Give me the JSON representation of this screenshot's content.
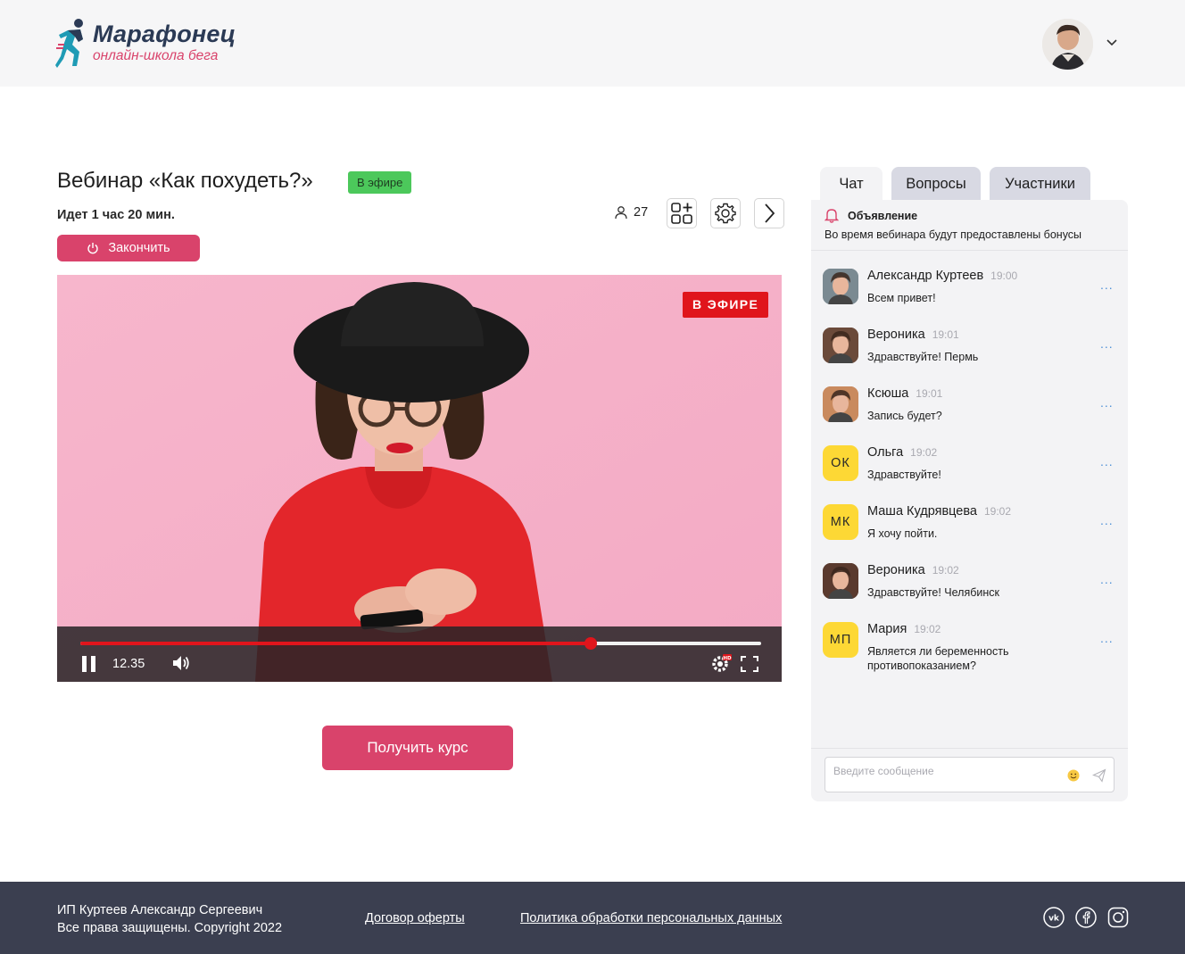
{
  "header": {
    "logo_title": "Марафонец",
    "logo_subtitle": "онлайн-школа бега"
  },
  "webinar": {
    "title": "Вебинар «Как похудеть?»",
    "live_badge": "В эфире",
    "elapsed": "Идет 1 час 20 мин.",
    "stop_label": "Закончить",
    "viewers": "27"
  },
  "video": {
    "live_label": "В ЭФИРЕ",
    "time": "12.35",
    "progress": 0.75
  },
  "cta": {
    "label": "Получить курс"
  },
  "chat": {
    "tabs": [
      {
        "label": "Чат"
      },
      {
        "label": "Вопросы"
      },
      {
        "label": "Участники"
      }
    ],
    "announcement": {
      "title": "Объявление",
      "text": "Во время вебинара будут предоставлены бонусы"
    },
    "messages": [
      {
        "name": "Александр Куртеев",
        "time": "19:00",
        "text": "Всем привет!",
        "initials": "",
        "avatar_color": "#7b8a92"
      },
      {
        "name": "Вероника",
        "time": "19:01",
        "text": "Здравствуйте! Пермь",
        "initials": "",
        "avatar_color": "#6b4a3a"
      },
      {
        "name": "Ксюша",
        "time": "19:01",
        "text": "Запись будет?",
        "initials": "",
        "avatar_color": "#c98a5e"
      },
      {
        "name": "Ольга",
        "time": "19:02",
        "text": "Здравствуйте!",
        "initials": "ОК",
        "avatar_color": "#fdd835"
      },
      {
        "name": "Маша Кудрявцева",
        "time": "19:02",
        "text": "Я хочу пойти.",
        "initials": "МК",
        "avatar_color": "#fdd835"
      },
      {
        "name": "Вероника",
        "time": "19:02",
        "text": "Здравствуйте! Челябинск",
        "initials": "",
        "avatar_color": "#5a3a2e"
      },
      {
        "name": "Мария",
        "time": "19:02",
        "text": "Является ли беременность противопоказанием?",
        "initials": "МП",
        "avatar_color": "#fdd835"
      }
    ],
    "more_label": "...",
    "input_placeholder": "Введите сообщение"
  },
  "footer": {
    "company": "ИП Куртеев Александр Сергеевич",
    "rights": "Все права защищены. Copyright 2022",
    "offer_link": "Договор оферты",
    "privacy_link": "Политика обработки персональных данных"
  },
  "colors": {
    "accent": "#d9436b",
    "live_green": "#4cc85b",
    "live_red": "#e0151c",
    "footer_bg": "#3b3f50",
    "initials_avatar": "#fdd835"
  },
  "icons": [
    "runner-logo-icon",
    "user-avatar",
    "chevron-down-icon",
    "power-icon",
    "user-icon",
    "add-widget-icon",
    "gear-icon",
    "chevron-right-icon",
    "pause-icon",
    "volume-icon",
    "settings-hd-icon",
    "fullscreen-icon",
    "bell-icon",
    "emoji-icon",
    "send-icon",
    "vk-icon",
    "facebook-icon",
    "instagram-icon"
  ]
}
